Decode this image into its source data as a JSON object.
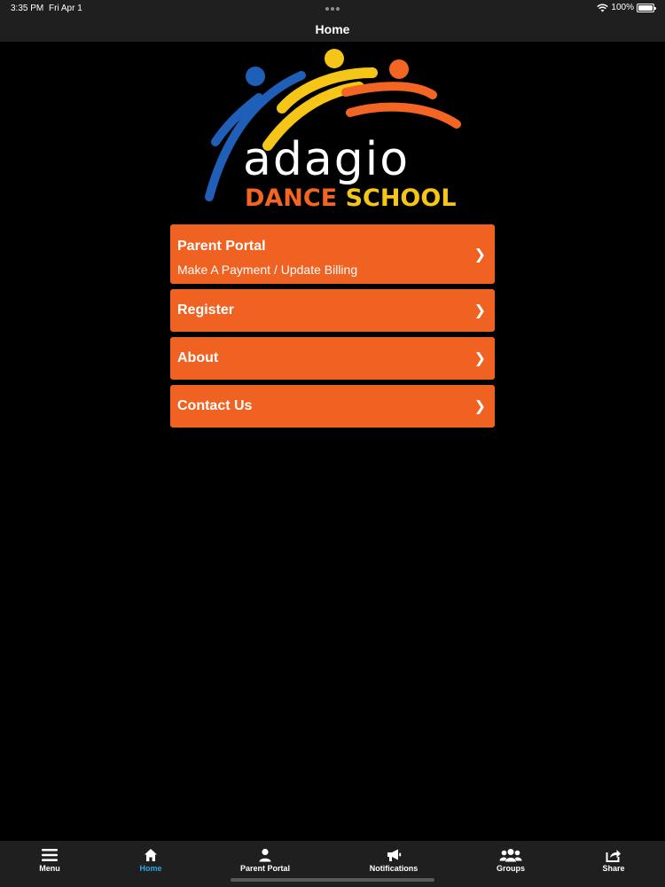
{
  "status": {
    "time": "3:35 PM",
    "date": "Fri Apr 1",
    "battery": "100%",
    "battery_level": 1.0
  },
  "header": {
    "title": "Home"
  },
  "logo": {
    "word": "adagio",
    "dance": "DANCE",
    "school": "SCHOOL"
  },
  "menu": [
    {
      "label": "Parent Portal",
      "sub": "Make A Payment / Update Billing"
    },
    {
      "label": "Register"
    },
    {
      "label": "About"
    },
    {
      "label": "Contact Us"
    }
  ],
  "chevron": "❯",
  "tabs": [
    {
      "label": "Menu",
      "icon": "menu-icon"
    },
    {
      "label": "Home",
      "icon": "home-icon",
      "active": true
    },
    {
      "label": "Parent Portal",
      "icon": "person-icon"
    },
    {
      "label": "Notifications",
      "icon": "megaphone-icon"
    },
    {
      "label": "Groups",
      "icon": "groups-icon"
    },
    {
      "label": "Share",
      "icon": "share-icon"
    }
  ],
  "colors": {
    "accent_orange": "#F06222",
    "active_tab": "#2DA8E8",
    "bar_bg": "#1F1F1F",
    "logo_blue": "#1F5FB8",
    "logo_yellow": "#F5C518"
  }
}
